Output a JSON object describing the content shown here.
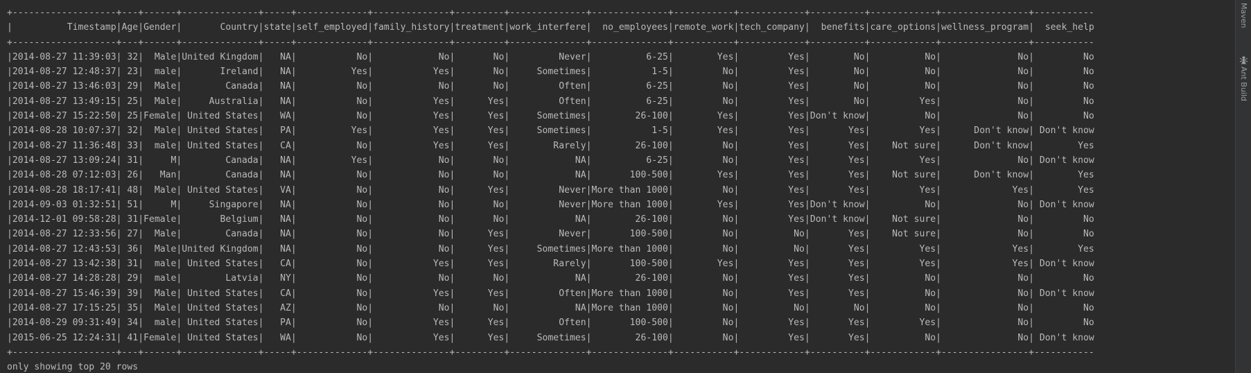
{
  "console": {
    "lines": [
      "+-------------------+---+------+--------------+-----+-------------+--------------+---------+--------------+--------------+-----------+------------+----------+------------+----------------+-----------",
      "|          Timestamp|Age|Gender|       Country|state|self_employed|family_history|treatment|work_interfere|  no_employees|remote_work|tech_company|  benefits|care_options|wellness_program|  seek_help",
      "+-------------------+---+------+--------------+-----+-------------+--------------+---------+--------------+--------------+-----------+------------+----------+------------+----------------+-----------",
      "|2014-08-27 11:39:03| 32|  Male|United Kingdom|   NA|           No|            No|       No|         Never|          6-25|        Yes|         Yes|        No|          No|              No|         No",
      "|2014-08-27 12:48:37| 23|  male|       Ireland|   NA|          Yes|           Yes|       No|     Sometimes|           1-5|         No|         Yes|        No|          No|              No|         No",
      "|2014-08-27 13:46:03| 29|  Male|        Canada|   NA|           No|            No|       No|         Often|          6-25|         No|         Yes|        No|          No|              No|         No",
      "|2014-08-27 13:49:15| 25|  Male|     Australia|   NA|           No|           Yes|      Yes|         Often|          6-25|         No|         Yes|        No|         Yes|              No|         No",
      "|2014-08-27 15:22:50| 25|Female| United States|   WA|           No|           Yes|      Yes|     Sometimes|        26-100|        Yes|         Yes|Don't know|          No|              No|         No",
      "|2014-08-28 10:07:37| 32|  Male| United States|   PA|          Yes|           Yes|      Yes|     Sometimes|           1-5|        Yes|         Yes|       Yes|         Yes|      Don't know| Don't know",
      "|2014-08-27 11:36:48| 33|  male| United States|   CA|           No|           Yes|      Yes|        Rarely|        26-100|         No|         Yes|       Yes|    Not sure|      Don't know|        Yes",
      "|2014-08-27 13:09:24| 31|     M|        Canada|   NA|          Yes|            No|       No|            NA|          6-25|         No|         Yes|       Yes|         Yes|              No| Don't know",
      "|2014-08-28 07:12:03| 26|   Man|        Canada|   NA|           No|            No|       No|            NA|       100-500|        Yes|         Yes|       Yes|    Not sure|      Don't know|        Yes",
      "|2014-08-28 18:17:41| 48|  Male| United States|   VA|           No|            No|      Yes|         Never|More than 1000|         No|         Yes|       Yes|         Yes|             Yes|        Yes",
      "|2014-09-03 01:32:51| 51|     M|     Singapore|   NA|           No|            No|       No|         Never|More than 1000|        Yes|         Yes|Don't know|          No|              No| Don't know",
      "|2014-12-01 09:58:28| 31|Female|       Belgium|   NA|           No|            No|       No|            NA|        26-100|         No|         Yes|Don't know|    Not sure|              No|         No",
      "|2014-08-27 12:33:56| 27|  Male|        Canada|   NA|           No|            No|      Yes|         Never|       100-500|         No|          No|       Yes|    Not sure|              No|         No",
      "|2014-08-27 12:43:53| 36|  Male|United Kingdom|   NA|           No|            No|      Yes|     Sometimes|More than 1000|         No|          No|       Yes|         Yes|             Yes|        Yes",
      "|2014-08-27 13:42:38| 31|  male| United States|   CA|           No|           Yes|      Yes|        Rarely|       100-500|        Yes|         Yes|       Yes|         Yes|             Yes| Don't know",
      "|2014-08-27 14:28:28| 29|  male|        Latvia|   NY|           No|            No|       No|            NA|        26-100|         No|         Yes|       Yes|          No|              No|         No",
      "|2014-08-27 15:46:39| 39|  Male| United States|   CA|           No|           Yes|      Yes|         Often|More than 1000|         No|         Yes|       Yes|          No|              No| Don't know",
      "|2014-08-27 17:15:25| 35|  Male| United States|   AZ|           No|            No|       No|            NA|More than 1000|         No|          No|        No|          No|              No|         No",
      "|2014-08-29 09:31:49| 34|  male| United States|   PA|           No|           Yes|      Yes|         Often|       100-500|         No|         Yes|       Yes|         Yes|              No|         No",
      "|2015-06-25 12:24:31| 41|Female| United States|   WA|           No|           Yes|      Yes|     Sometimes|        26-100|         No|         Yes|       Yes|          No|              No| Don't know",
      "+-------------------+---+------+--------------+-----+-------------+--------------+---------+--------------+--------------+-----------+------------+----------+------------+----------------+-----------",
      "only showing top 20 rows"
    ]
  },
  "side_tools": {
    "maven": {
      "label": "Maven",
      "icon": "maven-icon"
    },
    "ant_build": {
      "label": "Ant Build",
      "icon": "ant-icon"
    }
  },
  "colors": {
    "background": "#2b2b2b",
    "text": "#bababa",
    "toolbar": "#313335"
  }
}
